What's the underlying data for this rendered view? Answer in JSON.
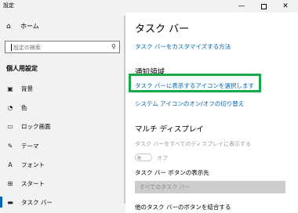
{
  "window": {
    "title": "設定",
    "minimize_glyph": "—",
    "close_glyph": "✕"
  },
  "sidebar": {
    "home_label": "ホーム",
    "search_placeholder": "設定の検索",
    "section_heading": "個人用設定",
    "items": [
      {
        "label": "背景",
        "icon": "picture-icon",
        "glyph": "▣"
      },
      {
        "label": "色",
        "icon": "palette-icon",
        "glyph": "◔"
      },
      {
        "label": "ロック画面",
        "icon": "lock-screen-icon",
        "glyph": "▭"
      },
      {
        "label": "テーマ",
        "icon": "brush-icon",
        "glyph": "✎"
      },
      {
        "label": "フォント",
        "icon": "font-icon",
        "glyph": "A"
      },
      {
        "label": "スタート",
        "icon": "start-icon",
        "glyph": "⊞"
      },
      {
        "label": "タスク バー",
        "icon": "taskbar-icon",
        "glyph": "▬"
      }
    ],
    "active_index": 6
  },
  "main": {
    "page_title": "タスク バー",
    "customize_link": "タスク バーをカスタマイズする方法",
    "notification_area_title": "通知領域",
    "select_icons_link": "タスク バーに表示するアイコンを選択します",
    "system_icons_link": "システム アイコンのオン/オフの切り替え",
    "multi_display_title": "マルチ ディスプレイ",
    "show_all_displays_label": "タスク バーをすべてのディスプレイに表示する",
    "toggle_state": "オフ",
    "buttons_location_label": "タスク バー ボタンの表示先",
    "buttons_location_value": "すべてのタスク バー",
    "combine_buttons_label": "他のタスク バーのボタンを結合する"
  },
  "colors": {
    "accent": "#0066b4",
    "highlight_box": "#19a84a",
    "sidebar_bg": "#f2f2f2"
  }
}
